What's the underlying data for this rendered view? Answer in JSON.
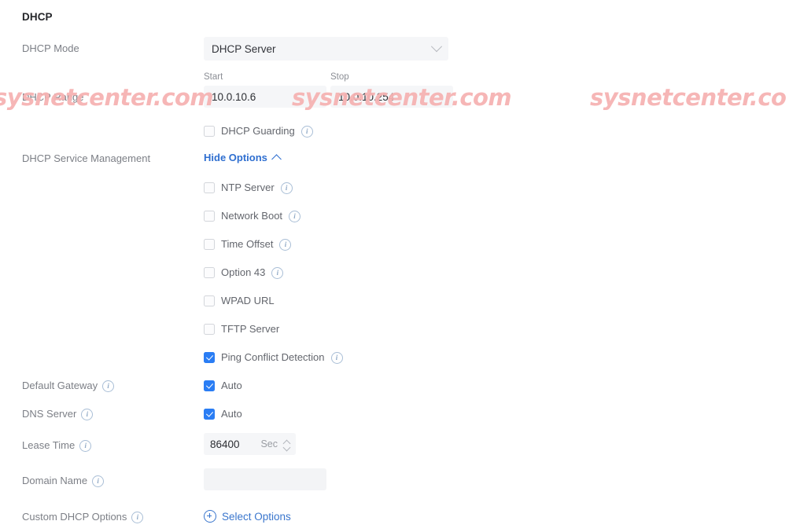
{
  "section": {
    "title": "DHCP"
  },
  "colors": {
    "accent": "#2a7df4",
    "link": "#3a76cd",
    "label": "#7c7f86",
    "field_bg": "#f5f6f8",
    "watermark": "#f6b3b3"
  },
  "watermarks": [
    "sysnetcenter.com",
    "sysnetcenter.com",
    "sysnetcenter.co"
  ],
  "fields": {
    "dhcp_mode": {
      "label": "DHCP Mode",
      "value": "DHCP Server",
      "icon": "chevron-down-icon"
    },
    "dhcp_range": {
      "label": "DHCP Range",
      "start_caption": "Start",
      "start_value": "10.0.10.6",
      "stop_caption": "Stop",
      "stop_value": "10.0.10.254"
    },
    "dhcp_guarding": {
      "label": "DHCP Guarding",
      "checked": false,
      "has_info": true
    },
    "dhcp_service_management": {
      "label": "DHCP Service Management",
      "toggle_label": "Hide Options",
      "toggle_icon": "chevron-up-icon"
    },
    "default_gateway": {
      "label": "Default Gateway",
      "option_label": "Auto",
      "checked": true,
      "has_info": true
    },
    "dns_server": {
      "label": "DNS Server",
      "option_label": "Auto",
      "checked": true,
      "has_info": true
    },
    "lease_time": {
      "label": "Lease Time",
      "value": "86400",
      "unit": "Sec",
      "has_info": true
    },
    "domain_name": {
      "label": "Domain Name",
      "value": "",
      "placeholder": "",
      "has_info": true
    },
    "custom_dhcp_options": {
      "label": "Custom DHCP Options",
      "action_label": "Select Options",
      "action_icon": "plus-circle-icon",
      "has_info": true
    }
  },
  "service_options": [
    {
      "label": "NTP Server",
      "checked": false,
      "has_info": true
    },
    {
      "label": "Network Boot",
      "checked": false,
      "has_info": true
    },
    {
      "label": "Time Offset",
      "checked": false,
      "has_info": true
    },
    {
      "label": "Option 43",
      "checked": false,
      "has_info": true
    },
    {
      "label": "WPAD URL",
      "checked": false,
      "has_info": false
    },
    {
      "label": "TFTP Server",
      "checked": false,
      "has_info": false
    },
    {
      "label": "Ping Conflict Detection",
      "checked": true,
      "has_info": true
    }
  ]
}
